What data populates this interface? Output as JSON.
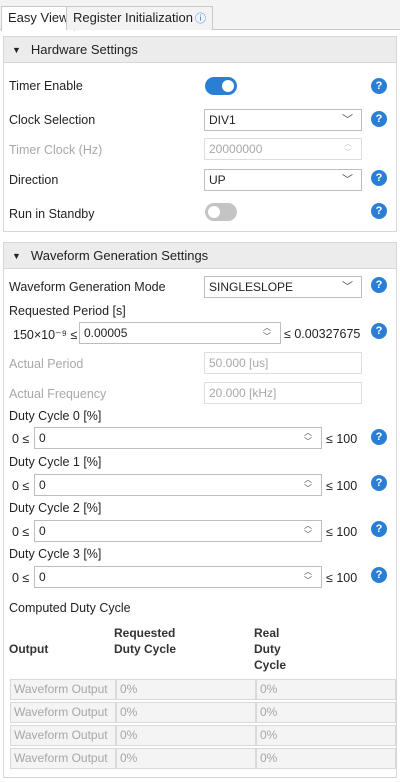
{
  "tabs": [
    {
      "label": "Easy View"
    },
    {
      "label": "Register Initialization"
    }
  ],
  "info_glyph": "ⓘ",
  "hardware": {
    "title": "Hardware Settings",
    "timer_enable": {
      "label": "Timer Enable",
      "state": "on"
    },
    "clock_selection": {
      "label": "Clock Selection",
      "value": "DIV1"
    },
    "timer_clock": {
      "label": "Timer Clock (Hz)",
      "value": "20000000"
    },
    "direction": {
      "label": "Direction",
      "value": "UP"
    },
    "run_in_standby": {
      "label": "Run in Standby",
      "state": "off"
    }
  },
  "waveform": {
    "title": "Waveform Generation Settings",
    "mode": {
      "label": "Waveform Generation Mode",
      "value": "SINGLESLOPE"
    },
    "requested_period": {
      "label": "Requested Period [s]",
      "min_text": "150×10⁻⁹ ≤",
      "value": "0.00005",
      "max_text": "≤ 0.00327675"
    },
    "actual_period": {
      "label": "Actual Period",
      "value": "50.000 [us]"
    },
    "actual_frequency": {
      "label": "Actual Frequency",
      "value": "20.000 [kHz]"
    },
    "duty_cycles": [
      {
        "label": "Duty Cycle 0 [%]",
        "min_text": "0 ≤",
        "value": "0",
        "max_text": "≤ 100"
      },
      {
        "label": "Duty Cycle 1 [%]",
        "min_text": "0 ≤",
        "value": "0",
        "max_text": "≤ 100"
      },
      {
        "label": "Duty Cycle 2 [%]",
        "min_text": "0 ≤",
        "value": "0",
        "max_text": "≤ 100"
      },
      {
        "label": "Duty Cycle 3 [%]",
        "min_text": "0 ≤",
        "value": "0",
        "max_text": "≤ 100"
      }
    ],
    "computed": {
      "title": "Computed Duty Cycle",
      "headers": {
        "output": "Output",
        "requested": "Requested Duty Cycle",
        "real": "Real Duty Cycle"
      },
      "rows": [
        {
          "output": "Waveform Output",
          "requested": "0%",
          "real": "0%"
        },
        {
          "output": "Waveform Output",
          "requested": "0%",
          "real": "0%"
        },
        {
          "output": "Waveform Output",
          "requested": "0%",
          "real": "0%"
        },
        {
          "output": "Waveform Output",
          "requested": "0%",
          "real": "0%"
        }
      ]
    }
  },
  "glyphs": {
    "help": "?",
    "chevron": "﹀",
    "collapse": "▼",
    "spin_up": "︿",
    "spin_down": "﹀"
  },
  "colors": {
    "accent": "#2a7fd5",
    "toggle_off": "#c4c4c4",
    "disabled_text": "#a8a8a8"
  }
}
